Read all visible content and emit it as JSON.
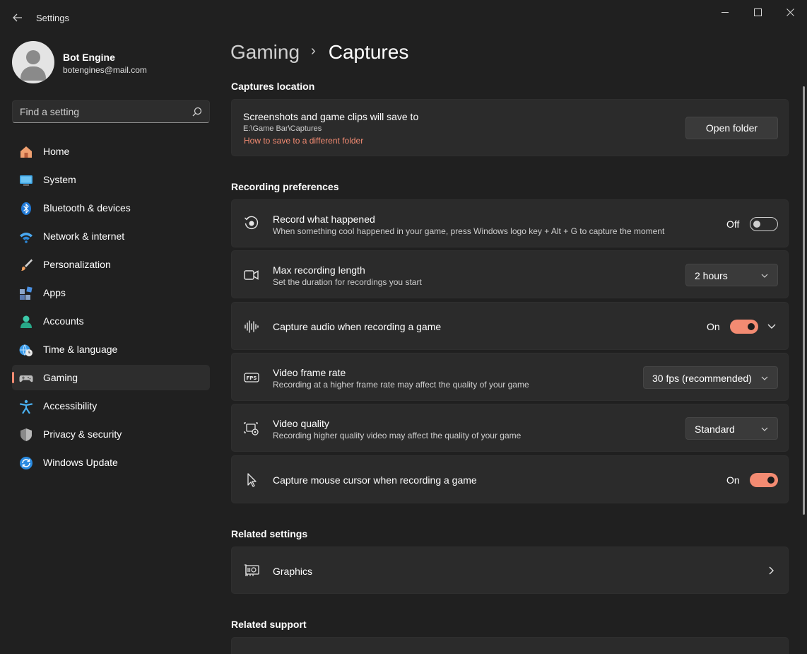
{
  "app": {
    "title": "Settings"
  },
  "profile": {
    "name": "Bot Engine",
    "email": "botengines@mail.com"
  },
  "search": {
    "placeholder": "Find a setting"
  },
  "nav": [
    {
      "label": "Home",
      "icon": "home-icon"
    },
    {
      "label": "System",
      "icon": "system-icon"
    },
    {
      "label": "Bluetooth & devices",
      "icon": "bluetooth-icon"
    },
    {
      "label": "Network & internet",
      "icon": "wifi-icon"
    },
    {
      "label": "Personalization",
      "icon": "brush-icon"
    },
    {
      "label": "Apps",
      "icon": "apps-icon"
    },
    {
      "label": "Accounts",
      "icon": "accounts-icon"
    },
    {
      "label": "Time & language",
      "icon": "time-language-icon"
    },
    {
      "label": "Gaming",
      "icon": "gamepad-icon",
      "active": true
    },
    {
      "label": "Accessibility",
      "icon": "accessibility-icon"
    },
    {
      "label": "Privacy & security",
      "icon": "shield-icon"
    },
    {
      "label": "Windows Update",
      "icon": "update-icon"
    }
  ],
  "breadcrumb": {
    "parent": "Gaming",
    "separator": "›",
    "current": "Captures"
  },
  "captures_location": {
    "heading": "Captures location",
    "title": "Screenshots and game clips will save to",
    "path": "E:\\Game Bar\\Captures",
    "link": "How to save to a different folder",
    "button": "Open folder"
  },
  "recording": {
    "heading": "Recording preferences",
    "record_what_happened": {
      "title": "Record what happened",
      "desc": "When something cool happened in your game, press Windows logo key + Alt + G to capture the moment",
      "state": "Off"
    },
    "max_length": {
      "title": "Max recording length",
      "desc": "Set the duration for recordings you start",
      "value": "2 hours"
    },
    "capture_audio": {
      "title": "Capture audio when recording a game",
      "state": "On"
    },
    "frame_rate": {
      "title": "Video frame rate",
      "desc": "Recording at a higher frame rate may affect the quality of your game",
      "value": "30 fps (recommended)"
    },
    "video_quality": {
      "title": "Video quality",
      "desc": "Recording higher quality video may affect the quality of your game",
      "value": "Standard"
    },
    "capture_cursor": {
      "title": "Capture mouse cursor when recording a game",
      "state": "On"
    }
  },
  "related_settings": {
    "heading": "Related settings",
    "graphics": "Graphics"
  },
  "related_support": {
    "heading": "Related support"
  },
  "colors": {
    "accent": "#f38b72",
    "background": "#202020",
    "card": "#2b2b2b"
  }
}
